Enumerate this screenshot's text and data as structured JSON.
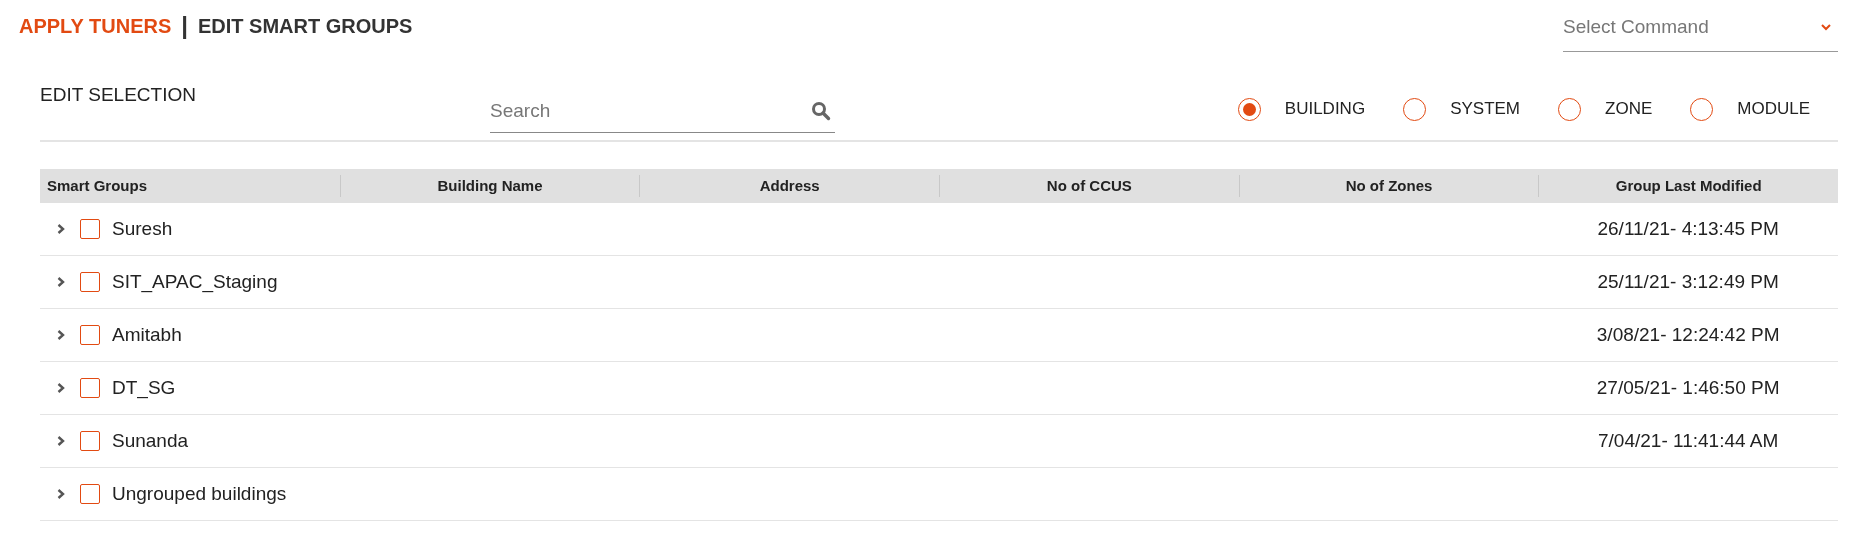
{
  "breadcrumb": {
    "link": "APPLY TUNERS",
    "separator": "|",
    "current": "EDIT SMART GROUPS"
  },
  "command_select": {
    "placeholder": "Select Command"
  },
  "selection": {
    "title": "EDIT SELECTION",
    "search": {
      "placeholder": "Search"
    },
    "options": [
      {
        "label": "BUILDING",
        "selected": true
      },
      {
        "label": "SYSTEM",
        "selected": false
      },
      {
        "label": "ZONE",
        "selected": false
      },
      {
        "label": "MODULE",
        "selected": false
      }
    ]
  },
  "table": {
    "columns": [
      "Smart Groups",
      "Building Name",
      "Address",
      "No of CCUS",
      "No of Zones",
      "Group Last Modified"
    ],
    "rows": [
      {
        "name": "Suresh",
        "checked": false,
        "expanded": false,
        "modified": "26/11/21- 4:13:45 PM"
      },
      {
        "name": "SIT_APAC_Staging",
        "checked": false,
        "expanded": false,
        "modified": "25/11/21- 3:12:49 PM"
      },
      {
        "name": "Amitabh",
        "checked": false,
        "expanded": false,
        "modified": "3/08/21- 12:24:42 PM"
      },
      {
        "name": "DT_SG",
        "checked": false,
        "expanded": false,
        "modified": "27/05/21- 1:46:50 PM"
      },
      {
        "name": "Sunanda",
        "checked": false,
        "expanded": false,
        "modified": "7/04/21- 11:41:44 AM"
      },
      {
        "name": "Ungrouped buildings",
        "checked": false,
        "expanded": false
      }
    ]
  }
}
